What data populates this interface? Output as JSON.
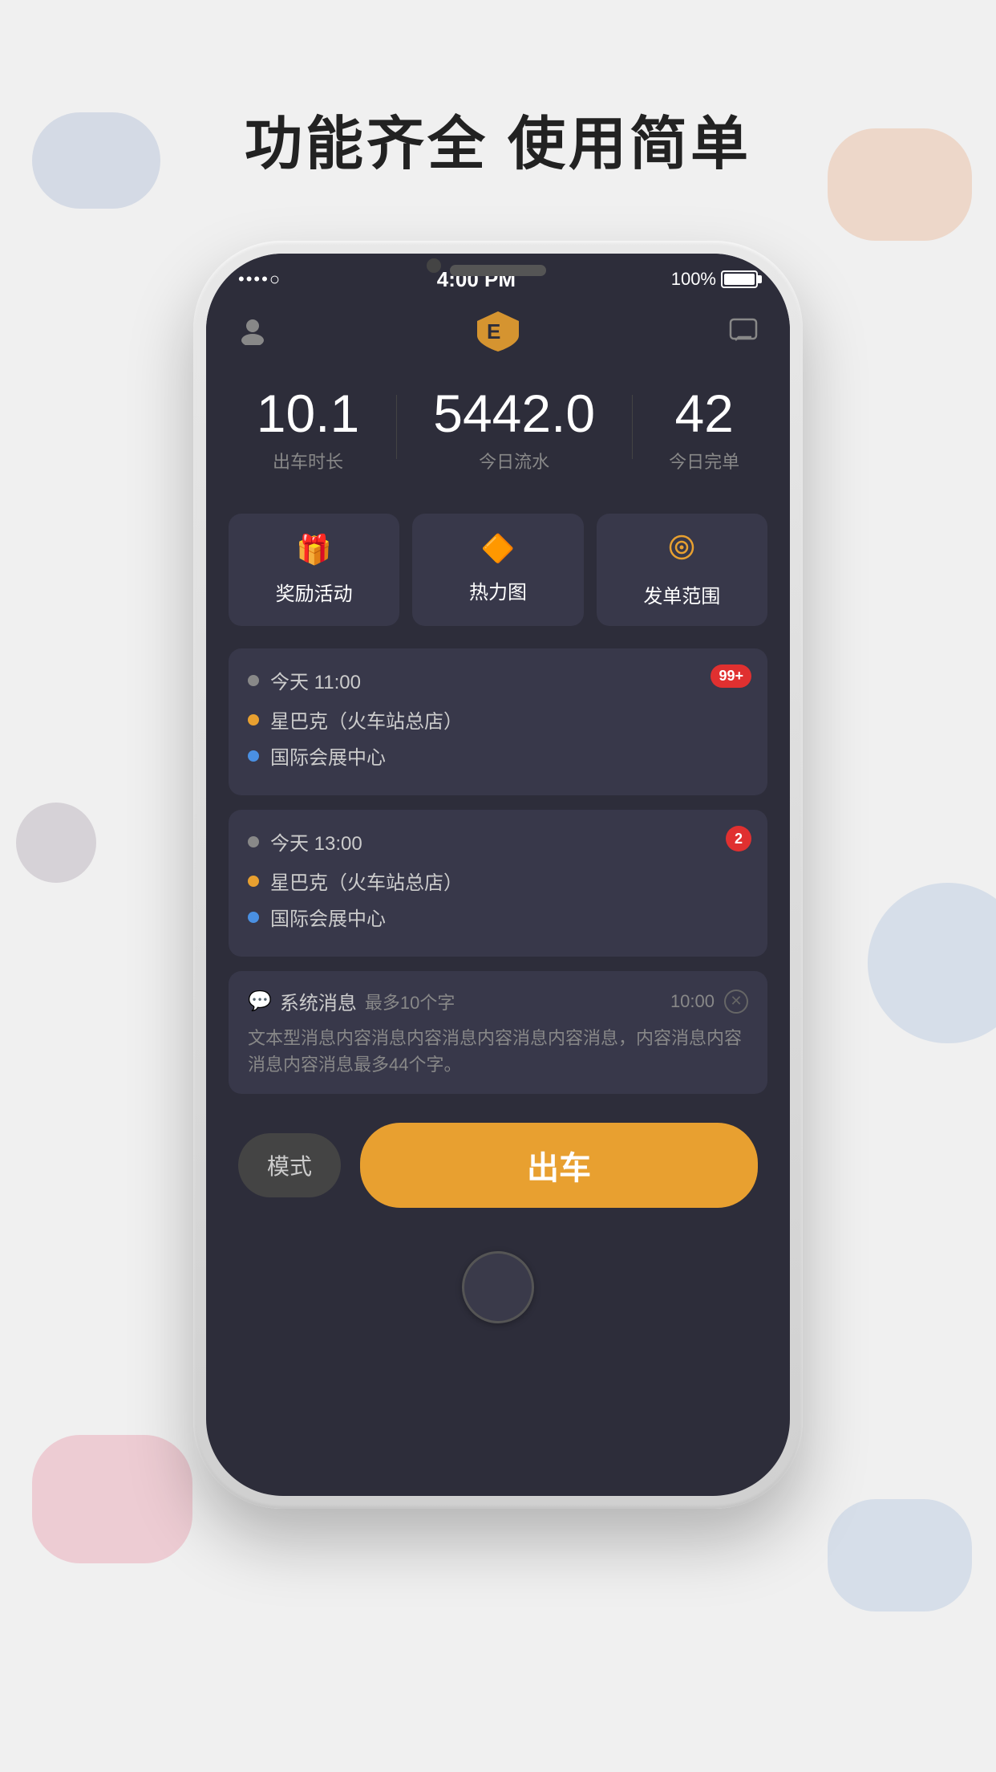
{
  "page": {
    "title": "功能齐全  使用简单",
    "bg_color": "#f0f0f0"
  },
  "status_bar": {
    "signal": "••••○",
    "time": "4:00 PM",
    "battery_text": "100%"
  },
  "header": {
    "avatar_icon": "person",
    "message_icon": "chat"
  },
  "stats": {
    "items": [
      {
        "value": "10.1",
        "label": "出车时长"
      },
      {
        "value": "5442.0",
        "label": "今日流水"
      },
      {
        "value": "42",
        "label": "今日完单"
      }
    ]
  },
  "quick_actions": [
    {
      "label": "奖励活动",
      "icon": "🎁"
    },
    {
      "label": "热力图",
      "icon": "🔥"
    },
    {
      "label": "发单范围",
      "icon": "⚙"
    }
  ],
  "orders": [
    {
      "time": "今天  11:00",
      "badge": "99+",
      "badge_large": true,
      "pickup": "星巴克（火车站总店）",
      "dropoff": "国际会展中心"
    },
    {
      "time": "今天  13:00",
      "badge": "2",
      "badge_large": false,
      "pickup": "星巴克（火车站总店）",
      "dropoff": "国际会展中心"
    }
  ],
  "system_message": {
    "title": "系统消息",
    "limit": "最多10个字",
    "time": "10:00",
    "body": "文本型消息内容消息内容消息内容消息内容消息，内容消息内容消息内容消息最多44个字。"
  },
  "bottom_bar": {
    "mode_label": "模式",
    "go_label": "出车"
  }
}
